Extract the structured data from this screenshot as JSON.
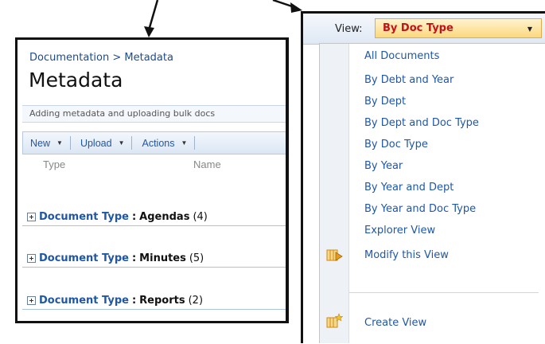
{
  "left_panel": {
    "breadcrumb": {
      "parent": "Documentation",
      "separator": ">",
      "current": "Metadata"
    },
    "title": "Metadata",
    "description": "Adding metadata and uploading bulk docs",
    "toolbar": {
      "new_label": "New",
      "upload_label": "Upload",
      "actions_label": "Actions"
    },
    "columns": {
      "type": "Type",
      "name": "Name"
    },
    "groups": [
      {
        "label": "Document Type",
        "separator": ":",
        "value": "Agendas",
        "count": "(4)"
      },
      {
        "label": "Document Type",
        "separator": ":",
        "value": "Minutes",
        "count": "(5)"
      },
      {
        "label": "Document Type",
        "separator": ":",
        "value": "Reports",
        "count": "(2)"
      }
    ]
  },
  "right_panel": {
    "view_label": "View:",
    "selected_view": "By Doc Type",
    "menu_items": [
      "All Documents",
      "By Debt and Year",
      "By Dept",
      "By Dept and Doc Type",
      "By Doc Type",
      "By Year",
      "By Year and Dept",
      "By Year and Doc Type",
      "Explorer View"
    ],
    "actions": {
      "modify": "Modify this View",
      "create": "Create View"
    }
  },
  "icons": {
    "expander": "plus-box-icon",
    "dropdown": "chevron-down-icon",
    "modify": "modify-view-icon",
    "create": "create-view-icon"
  },
  "colors": {
    "link_blue": "#1f57a5",
    "selected_red": "#c1121b",
    "select_background": "#fbd87e",
    "icon_orange": "#e59a1c"
  }
}
